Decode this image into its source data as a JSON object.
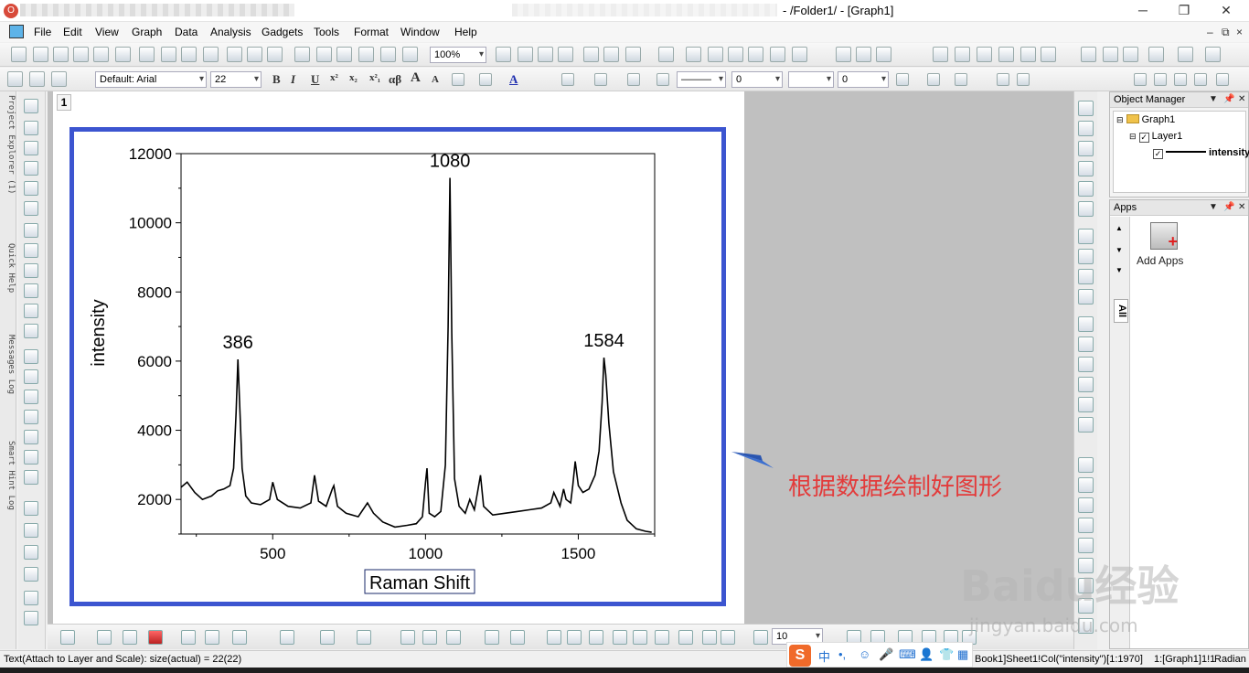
{
  "window": {
    "title": "- /Folder1/ - [Graph1]",
    "minimize": "─",
    "restore": "❐",
    "close": "✕"
  },
  "menu": {
    "items": [
      "File",
      "Edit",
      "View",
      "Graph",
      "Data",
      "Analysis",
      "Gadgets",
      "Tools",
      "Format",
      "Window",
      "Help"
    ],
    "mdi_minimize": "‒",
    "mdi_restore": "⧉",
    "mdi_close": "×"
  },
  "toolbar": {
    "zoom": "100%",
    "font_name": "Default: Arial",
    "font_size": "22",
    "bold": "B",
    "italic": "I",
    "underline": "U",
    "superscript": "x²",
    "subscript": "x₂",
    "greek": "αβ",
    "bigger": "A",
    "smaller": "A",
    "line_width": "0",
    "pattern_width": "0",
    "bottom_size": "10"
  },
  "side_tabs": [
    "Project Explorer (1)",
    "Quick Help",
    "Messages Log",
    "Smart Hint Log"
  ],
  "page_tab": "1",
  "chart_data": {
    "type": "line",
    "xlabel": "Raman Shift",
    "ylabel": "intensity",
    "xlim": [
      200,
      1750
    ],
    "ylim": [
      1000,
      12000
    ],
    "xticks": [
      500,
      1000,
      1500
    ],
    "yticks": [
      2000,
      4000,
      6000,
      8000,
      10000,
      12000
    ],
    "series": [
      {
        "name": "intensity",
        "x": [
          200,
          220,
          245,
          270,
          300,
          320,
          340,
          360,
          372,
          380,
          386,
          392,
          400,
          412,
          430,
          460,
          490,
          500,
          515,
          550,
          590,
          625,
          637,
          650,
          675,
          695,
          700,
          712,
          740,
          780,
          810,
          830,
          860,
          900,
          940,
          970,
          990,
          1000,
          1005,
          1012,
          1030,
          1050,
          1065,
          1074,
          1080,
          1086,
          1095,
          1110,
          1130,
          1145,
          1160,
          1170,
          1180,
          1190,
          1220,
          1260,
          1300,
          1340,
          1380,
          1410,
          1420,
          1440,
          1452,
          1460,
          1475,
          1482,
          1490,
          1500,
          1515,
          1535,
          1555,
          1568,
          1578,
          1584,
          1590,
          1600,
          1615,
          1640,
          1660,
          1690,
          1720,
          1740
        ],
        "y": [
          2350,
          2500,
          2200,
          2000,
          2100,
          2250,
          2300,
          2400,
          2900,
          4500,
          6050,
          4700,
          2900,
          2100,
          1900,
          1850,
          2000,
          2500,
          2000,
          1800,
          1750,
          1900,
          2700,
          1950,
          1800,
          2300,
          2400,
          1800,
          1600,
          1500,
          1900,
          1600,
          1350,
          1200,
          1250,
          1300,
          1500,
          2500,
          2900,
          1600,
          1500,
          1650,
          3000,
          7000,
          11300,
          6800,
          2600,
          1800,
          1600,
          2000,
          1700,
          2200,
          2700,
          1800,
          1550,
          1600,
          1650,
          1700,
          1750,
          1900,
          2200,
          1800,
          2300,
          2000,
          1900,
          2400,
          3100,
          2400,
          2200,
          2300,
          2700,
          3400,
          4800,
          6100,
          5600,
          4200,
          2800,
          1900,
          1400,
          1150,
          1080,
          1050
        ]
      }
    ],
    "peak_labels": [
      {
        "text": "386",
        "x": 386,
        "y": 6050
      },
      {
        "text": "1080",
        "x": 1080,
        "y": 11300
      },
      {
        "text": "1584",
        "x": 1584,
        "y": 6100
      }
    ]
  },
  "annotation": "根据数据绘制好图形",
  "object_manager": {
    "title": "Object Manager",
    "graph": "Graph1",
    "layer": "Layer1",
    "plot": "intensity"
  },
  "apps": {
    "title": "Apps",
    "all_tab": "All",
    "add_apps": "Add Apps"
  },
  "status": {
    "left": "Text(Attach to Layer and Scale): size(actual) = 22(22)",
    "book": "Book1]Sheet1!Col(\"intensity\")[1:1970]",
    "layer": "1:[Graph1]1!1",
    "angle": "Radian"
  },
  "ime": {
    "logo": "S",
    "lang": "中",
    "punct": "•,"
  },
  "watermark": {
    "brand": "Baidu经验",
    "url": "jingyan.baidu.com"
  }
}
